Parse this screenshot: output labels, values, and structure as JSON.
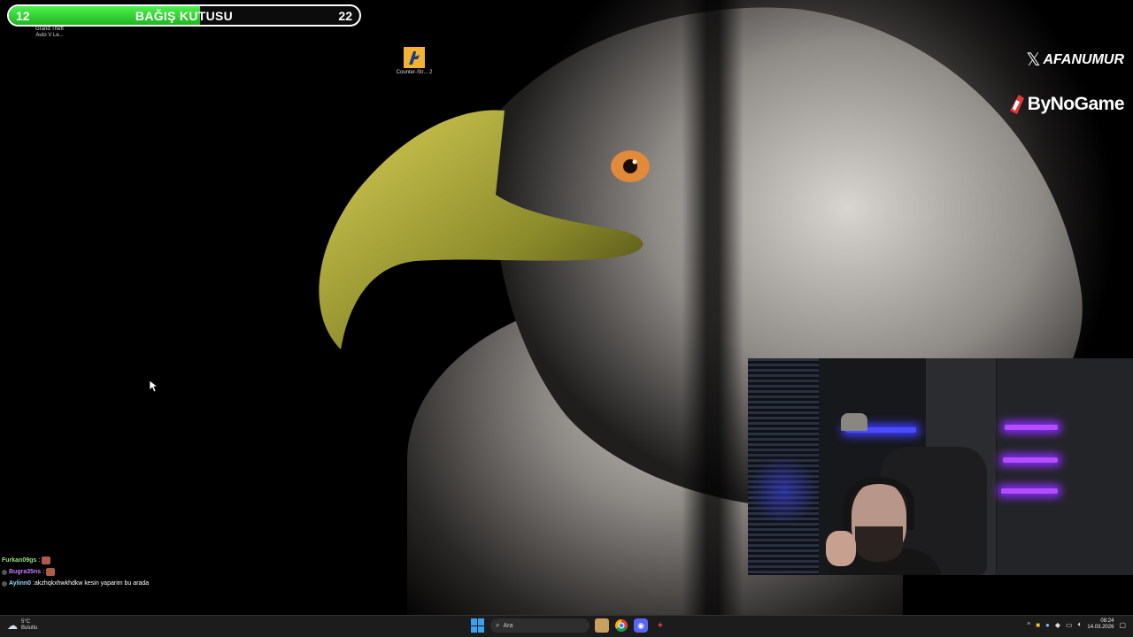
{
  "donation": {
    "current": "12",
    "title": "BAĞIŞ KUTUSU",
    "goal": "22",
    "progress_fraction": 0.545
  },
  "desktop_icons": [
    {
      "label": "Grand Theft Auto V Le...",
      "icon": "gta-icon"
    },
    {
      "label": "Counter-Str... 2",
      "icon": "counter-strike-icon"
    }
  ],
  "branding": {
    "x_handle": "AFANUMUR",
    "sponsor": "ByNoGame"
  },
  "chat": [
    {
      "user": "Furkan09gs",
      "message": "",
      "color": "#9be37a"
    },
    {
      "user": "Bugra35ns",
      "message": "",
      "color": "#c77dff"
    },
    {
      "user": "Aylinn0",
      "message": "akzhqkxhwkhdkw kesin yaparim bu arada",
      "color": "#8fd9ff"
    }
  ],
  "taskbar": {
    "weather_temp": "5°C",
    "weather_desc": "Bulutlu",
    "search_placeholder": "Ara",
    "time": "08:24",
    "date": "14.03.2026"
  },
  "colors": {
    "progress": "#2ecc2e",
    "accent": "#3aa0f0"
  }
}
